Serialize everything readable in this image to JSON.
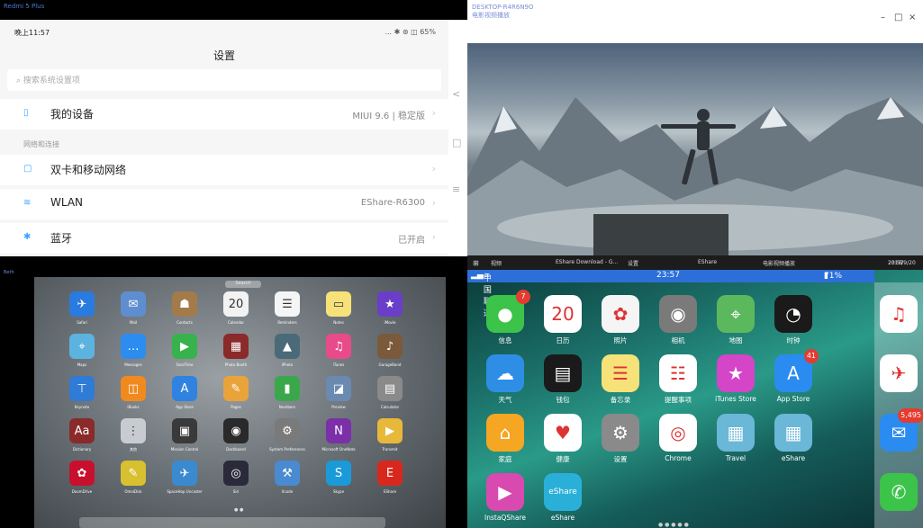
{
  "android": {
    "window_label": "Redmi 5 Plus",
    "status_time": "晚上11:57",
    "status_right": "... ✱ ⊛ ◫ 65%",
    "title": "设置",
    "search_placeholder": "搜索系统设置项",
    "my_device": {
      "label": "我的设备",
      "value": "MIUI 9.6 | 稳定版"
    },
    "section_network": "网络和连接",
    "dual_sim": {
      "label": "双卡和移动网络",
      "value": ""
    },
    "wlan": {
      "label": "WLAN",
      "value": "EShare-R6300"
    },
    "bluetooth": {
      "label": "蓝牙",
      "value": "已开启"
    },
    "side_controls": [
      "<",
      "□",
      "≡"
    ]
  },
  "windows": {
    "window_label": "DESKTOP-R4R6N9O",
    "window_sub": "电影视频播放",
    "controls": [
      "–",
      "□",
      "×"
    ],
    "taskbar": {
      "items": [
        "视频",
        "EShare Download - G...",
        "设置",
        "EShare",
        "电影视频播放"
      ],
      "time": "23:57",
      "date": "2018/9/20"
    }
  },
  "mac": {
    "window_label": "Beth",
    "search": "Search",
    "apps": [
      {
        "label": "Safari",
        "icon": "compass-icon",
        "color": "#2a7be0",
        "glyph": "✈"
      },
      {
        "label": "Mail",
        "icon": "mail-icon",
        "color": "#5e8ed0",
        "glyph": "✉"
      },
      {
        "label": "Contacts",
        "icon": "contacts-icon",
        "color": "#a47a4a",
        "glyph": "☗"
      },
      {
        "label": "Calendar",
        "icon": "calendar-icon",
        "color": "#f2f2f2",
        "glyph": "20"
      },
      {
        "label": "Reminders",
        "icon": "reminders-icon",
        "color": "#f5f5f5",
        "glyph": "☰"
      },
      {
        "label": "Notes",
        "icon": "notes-icon",
        "color": "#f7e27a",
        "glyph": "▭"
      },
      {
        "label": "iMovie",
        "icon": "imovie-icon",
        "color": "#6a3ec8",
        "glyph": "★"
      },
      {
        "label": "Maps",
        "icon": "maps-icon",
        "color": "#5db3e0",
        "glyph": "⌖"
      },
      {
        "label": "Messages",
        "icon": "messages-icon",
        "color": "#2d8cf0",
        "glyph": "…"
      },
      {
        "label": "FaceTime",
        "icon": "facetime-icon",
        "color": "#37b24d",
        "glyph": "▶"
      },
      {
        "label": "Photo Booth",
        "icon": "photobooth-icon",
        "color": "#8a2a2a",
        "glyph": "▦"
      },
      {
        "label": "iPhoto",
        "icon": "iphoto-icon",
        "color": "#4a6a7a",
        "glyph": "▲"
      },
      {
        "label": "iTunes",
        "icon": "itunes-icon",
        "color": "#e84b8a",
        "glyph": "♫"
      },
      {
        "label": "GarageBand",
        "icon": "garageband-icon",
        "color": "#7a5a3a",
        "glyph": "♪"
      },
      {
        "label": "Keynote",
        "icon": "keynote-icon",
        "color": "#2f7bd6",
        "glyph": "⊤"
      },
      {
        "label": "iBooks",
        "icon": "ibooks-icon",
        "color": "#f08a1e",
        "glyph": "◫"
      },
      {
        "label": "App Store",
        "icon": "appstore-icon",
        "color": "#2f82e0",
        "glyph": "A"
      },
      {
        "label": "Pages",
        "icon": "pages-icon",
        "color": "#e8a43a",
        "glyph": "✎"
      },
      {
        "label": "Numbers",
        "icon": "numbers-icon",
        "color": "#3aa84a",
        "glyph": "▮"
      },
      {
        "label": "Preview",
        "icon": "preview-icon",
        "color": "#6a8ab0",
        "glyph": "◪"
      },
      {
        "label": "Calculator",
        "icon": "calculator-icon",
        "color": "#8a8a8a",
        "glyph": "▤"
      },
      {
        "label": "Dictionary",
        "icon": "dictionary-icon",
        "color": "#8a2a2a",
        "glyph": "Aa"
      },
      {
        "label": "其他",
        "icon": "folder-icon",
        "color": "#c8ccd0",
        "glyph": "⋮"
      },
      {
        "label": "Mission Control",
        "icon": "missioncontrol-icon",
        "color": "#3a3a3a",
        "glyph": "▣"
      },
      {
        "label": "Dashboard",
        "icon": "dashboard-icon",
        "color": "#2a2a2a",
        "glyph": "◉"
      },
      {
        "label": "System Preferences",
        "icon": "gear-icon",
        "color": "#7a7a7a",
        "glyph": "⚙"
      },
      {
        "label": "Microsoft OneNote",
        "icon": "onenote-icon",
        "color": "#7b2fa8",
        "glyph": "N"
      },
      {
        "label": "Transmit",
        "icon": "transmit-icon",
        "color": "#e8b83a",
        "glyph": "▶"
      },
      {
        "label": "DoomDrive",
        "icon": "flower-icon",
        "color": "#c8102e",
        "glyph": "✿"
      },
      {
        "label": "OmniDisk",
        "icon": "omnidisk-icon",
        "color": "#d8c030",
        "glyph": "✎"
      },
      {
        "label": "SpaceHop Uncaster",
        "icon": "spacehop-icon",
        "color": "#3a8ad0",
        "glyph": "✈"
      },
      {
        "label": "Siri",
        "icon": "siri-icon",
        "color": "#2a2a3a",
        "glyph": "◎"
      },
      {
        "label": "Xcode",
        "icon": "xcode-icon",
        "color": "#4a8ad0",
        "glyph": "⚒"
      },
      {
        "label": "Skype",
        "icon": "skype-icon",
        "color": "#1a9ad8",
        "glyph": "S"
      },
      {
        "label": "EShare",
        "icon": "eshare-icon",
        "color": "#d8281e",
        "glyph": "E"
      }
    ]
  },
  "ipad": {
    "carrier": "中国联通",
    "time": "23:57",
    "battery": "71%",
    "apps": [
      {
        "label": "信息",
        "icon": "messages-icon",
        "color": "#3cc34a",
        "glyph": "●",
        "badge": "7"
      },
      {
        "label": "日历",
        "icon": "calendar-icon",
        "color": "#ffffff",
        "glyph": "20",
        "badge": ""
      },
      {
        "label": "照片",
        "icon": "photos-icon",
        "color": "#f5f5f5",
        "glyph": "✿",
        "badge": ""
      },
      {
        "label": "相机",
        "icon": "camera-icon",
        "color": "#7a7a7a",
        "glyph": "◉",
        "badge": ""
      },
      {
        "label": "地图",
        "icon": "maps-icon",
        "color": "#5cb85c",
        "glyph": "⌖",
        "badge": ""
      },
      {
        "label": "时钟",
        "icon": "clock-icon",
        "color": "#1a1a1a",
        "glyph": "◔",
        "badge": ""
      },
      {
        "label": "天气",
        "icon": "weather-icon",
        "color": "#2e8ee6",
        "glyph": "☁",
        "badge": ""
      },
      {
        "label": "钱包",
        "icon": "wallet-icon",
        "color": "#1a1a1a",
        "glyph": "▤",
        "badge": ""
      },
      {
        "label": "备忘录",
        "icon": "notes-icon",
        "color": "#f7e27a",
        "glyph": "☰",
        "badge": ""
      },
      {
        "label": "提醒事项",
        "icon": "reminders-icon",
        "color": "#ffffff",
        "glyph": "☷",
        "badge": ""
      },
      {
        "label": "iTunes Store",
        "icon": "itunes-store-icon",
        "color": "#d445c8",
        "glyph": "★",
        "badge": ""
      },
      {
        "label": "App Store",
        "icon": "appstore-icon",
        "color": "#2a8cf0",
        "glyph": "A",
        "badge": "41"
      },
      {
        "label": "家庭",
        "icon": "home-icon",
        "color": "#f5a623",
        "glyph": "⌂",
        "badge": ""
      },
      {
        "label": "健康",
        "icon": "health-icon",
        "color": "#ffffff",
        "glyph": "♥",
        "badge": ""
      },
      {
        "label": "设置",
        "icon": "gear-icon",
        "color": "#8a8a8a",
        "glyph": "⚙",
        "badge": ""
      },
      {
        "label": "Chrome",
        "icon": "chrome-icon",
        "color": "#ffffff",
        "glyph": "◎",
        "badge": ""
      },
      {
        "label": "Travel",
        "icon": "folder-icon",
        "color": "#6ab7d8",
        "glyph": "▦",
        "badge": ""
      },
      {
        "label": "eShare",
        "icon": "folder-icon",
        "color": "#6ab7d8",
        "glyph": "▦",
        "badge": ""
      },
      {
        "label": "InstaQShare",
        "icon": "benq-icon",
        "color": "#d84ab0",
        "glyph": "▶",
        "badge": ""
      },
      {
        "label": "eShare",
        "icon": "eshare-icon",
        "color": "#2ab0d8",
        "glyph": "eShare",
        "badge": ""
      }
    ],
    "dock": [
      {
        "label": "Music",
        "icon": "music-icon",
        "color": "#ffffff",
        "glyph": "♫",
        "badge": ""
      },
      {
        "label": "Safari",
        "icon": "safari-icon",
        "color": "#ffffff",
        "glyph": "✈",
        "badge": ""
      },
      {
        "label": "Mail",
        "icon": "mail-icon",
        "color": "#2a8cf0",
        "glyph": "✉",
        "badge": "5,495"
      },
      {
        "label": "Phone",
        "icon": "phone-icon",
        "color": "#3cc34a",
        "glyph": "✆",
        "badge": ""
      }
    ]
  }
}
